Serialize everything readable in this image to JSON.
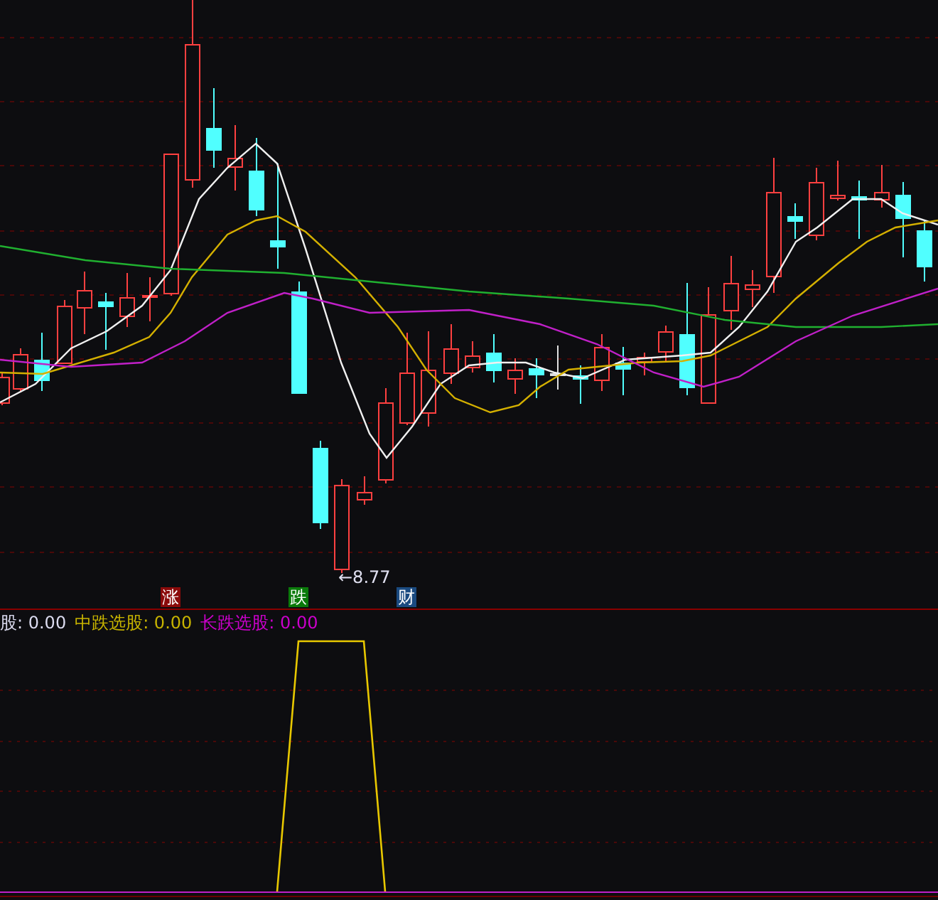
{
  "price_chart": {
    "low_label": "←8.77",
    "markers": [
      {
        "kind": "rise",
        "text": "涨"
      },
      {
        "kind": "fall",
        "text": "跌"
      },
      {
        "kind": "finance",
        "text": "财"
      }
    ]
  },
  "indicator_panel": {
    "legend": [
      {
        "label": "股:",
        "value": "0.00",
        "color": "#dcdcf0"
      },
      {
        "label": "中跌选股:",
        "value": "0.00",
        "color": "#c8b400"
      },
      {
        "label": "长跌选股:",
        "value": "0.00",
        "color": "#cc00cc"
      }
    ]
  }
}
